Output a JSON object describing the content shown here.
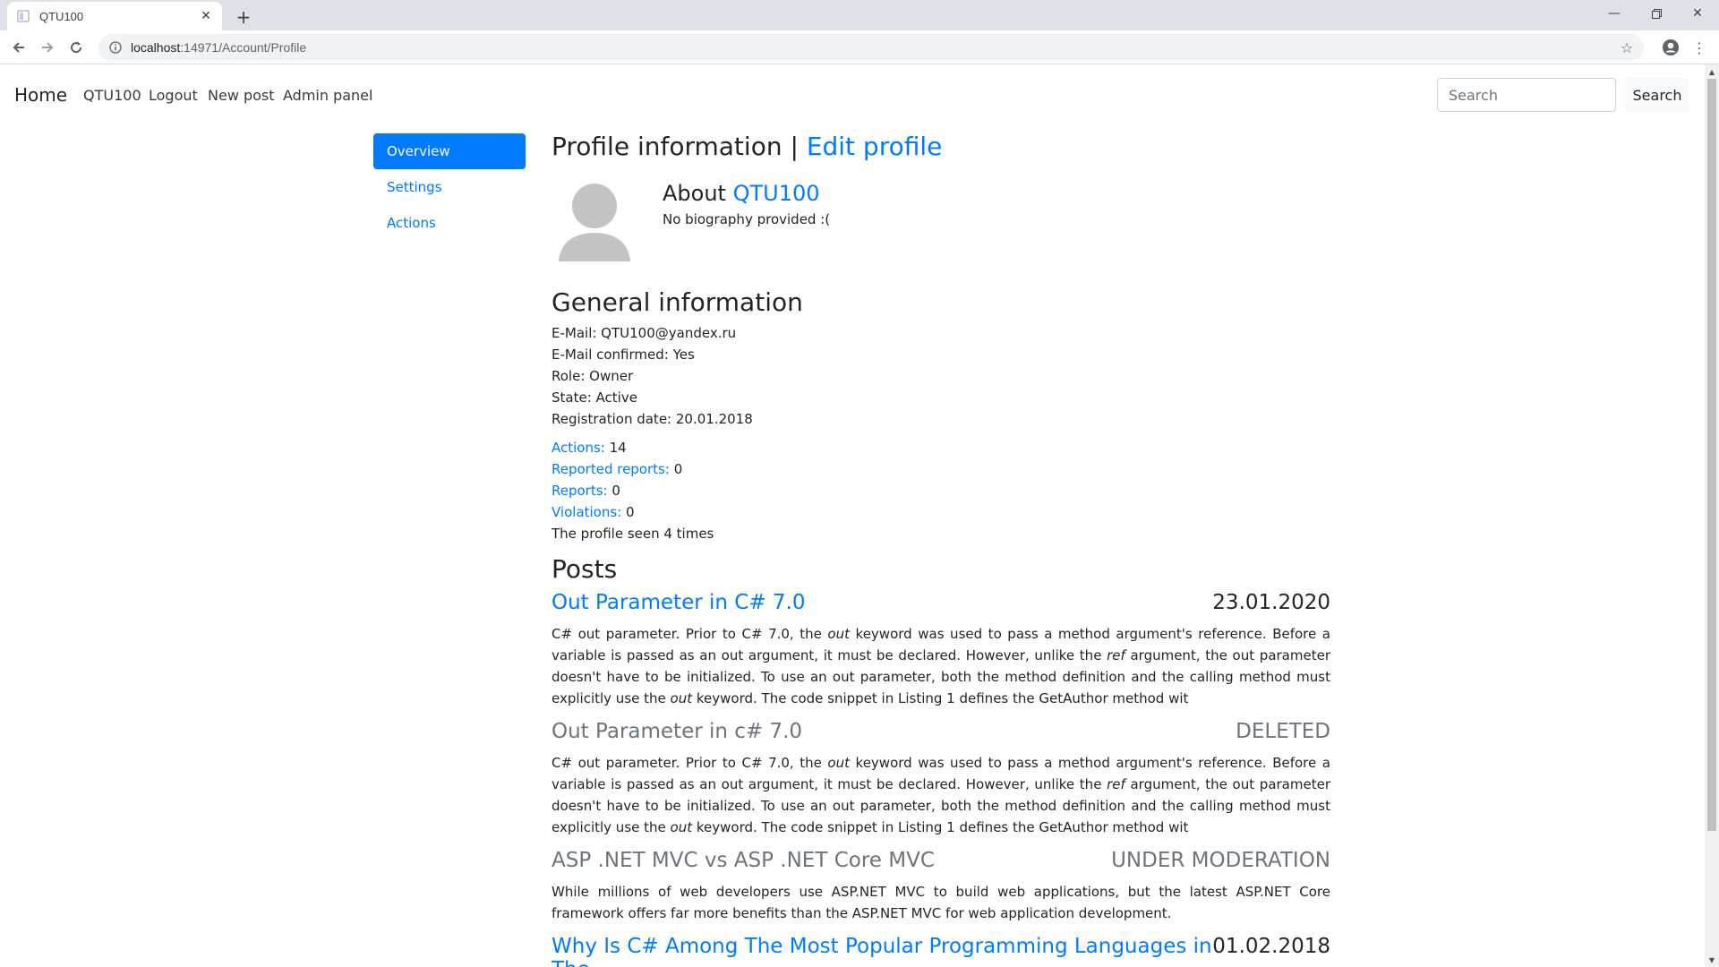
{
  "browser": {
    "tab_title": "QTU100",
    "url_host": "localhost",
    "url_rest": ":14971/Account/Profile"
  },
  "nav": {
    "brand": "Home",
    "links": [
      "QTU100",
      "Logout",
      "New post",
      "Admin panel"
    ],
    "search_placeholder": "Search",
    "search_button": "Search"
  },
  "sidebar": {
    "items": [
      {
        "label": "Overview",
        "active": true
      },
      {
        "label": "Settings",
        "active": false
      },
      {
        "label": "Actions",
        "active": false
      }
    ]
  },
  "profile": {
    "heading": "Profile information |",
    "edit_link": "Edit profile",
    "about_prefix": "About",
    "username": "QTU100",
    "bio": "No biography provided :("
  },
  "general": {
    "heading": "General information",
    "email": "E-Mail: QTU100@yandex.ru",
    "email_confirmed": "E-Mail confirmed: Yes",
    "role": "Role: Owner",
    "state": "State: Active",
    "registration": "Registration date: 20.01.2018",
    "stats": [
      {
        "label": "Actions:",
        "value": " 14"
      },
      {
        "label": "Reported reports:",
        "value": " 0"
      },
      {
        "label": "Reports:",
        "value": " 0"
      },
      {
        "label": "Violations:",
        "value": " 0"
      }
    ],
    "seen": "The profile seen 4 times"
  },
  "posts": {
    "heading": "Posts",
    "items": [
      {
        "title": "Out Parameter in C# 7.0",
        "status": "23.01.2020",
        "muted": false,
        "body_parts": [
          "C# out parameter. Prior to C# 7.0, the ",
          "out",
          " keyword was used to pass a method argument's reference. Before a variable is passed as an out argument, it must be declared. However, unlike the ",
          "ref",
          " argument, the out parameter doesn't have to be initialized. To use an out parameter, both the method definition and the calling method must explicitly use the ",
          "out",
          " keyword. The code snippet in Listing 1 defines the GetAuthor method wit"
        ]
      },
      {
        "title": "Out Parameter in c# 7.0",
        "status": "DELETED",
        "muted": true,
        "body_parts": [
          "C# out parameter. Prior to C# 7.0, the ",
          "out",
          " keyword was used to pass a method argument's reference. Before a variable is passed as an out argument, it must be declared. However, unlike the ",
          "ref",
          " argument, the out parameter doesn't have to be initialized. To use an out parameter, both the method definition and the calling method must explicitly use the ",
          "out",
          " keyword. The code snippet in Listing 1 defines the GetAuthor method wit"
        ]
      },
      {
        "title": "ASP .NET MVC vs ASP .NET Core MVC",
        "status": "UNDER MODERATION",
        "muted": true,
        "body_parts": [
          "While millions of web developers use ASP.NET MVC to build web applications, but the latest ASP.NET Core framework offers far more benefits than the ASP.NET MVC for web application development."
        ]
      },
      {
        "title": "Why Is C# Among The Most Popular Programming Languages in The",
        "status": "01.02.2018",
        "muted": false,
        "body_parts": []
      }
    ]
  }
}
